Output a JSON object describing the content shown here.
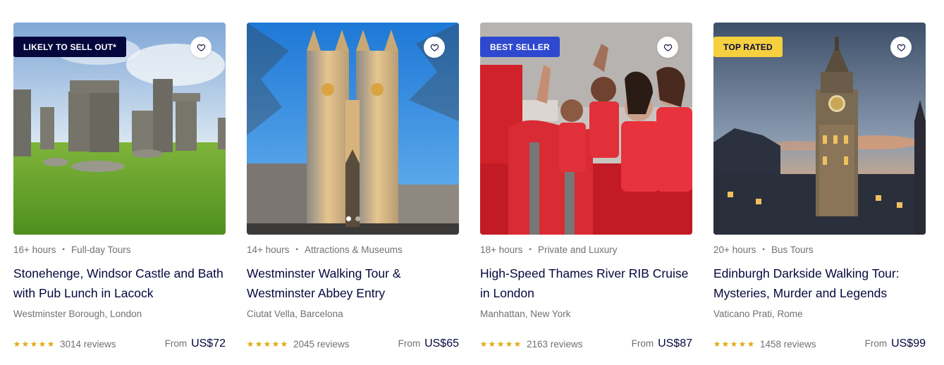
{
  "colors": {
    "heading": "#05073c",
    "muted": "#717171",
    "star": "#e2b123",
    "badge_dark": "#05073c",
    "badge_blue": "#2e48cf",
    "badge_yellow": "#f6d03f"
  },
  "cards": [
    {
      "badge": "LIKELY TO SELL OUT*",
      "badge_style": "dark",
      "image_icon": "stonehenge-photo",
      "duration": "16+ hours",
      "category": "Full-day Tours",
      "title": "Stonehenge, Windsor Castle and Bath with Pub Lunch in Lacock",
      "location": "Westminster Borough, London",
      "rating": 5,
      "reviews": "3014 reviews",
      "price_prefix": "From",
      "price": "US$72"
    },
    {
      "badge": "",
      "badge_style": "",
      "image_icon": "westminster-abbey-photo",
      "carousel_dots": 2,
      "carousel_active": 1,
      "duration": "14+ hours",
      "category": "Attractions & Museums",
      "title": "Westminster Walking Tour & Westminster Abbey Entry",
      "location": "Ciutat Vella, Barcelona",
      "rating": 5,
      "reviews": "2045 reviews",
      "price_prefix": "From",
      "price": "US$65"
    },
    {
      "badge": "BEST SELLER",
      "badge_style": "blue",
      "image_icon": "thames-rib-boat-photo",
      "duration": "18+ hours",
      "category": "Private and Luxury",
      "title": "High-Speed Thames River RIB Cruise in London",
      "location": "Manhattan, New York",
      "rating": 5,
      "reviews": "2163 reviews",
      "price_prefix": "From",
      "price": "US$87"
    },
    {
      "badge": "TOP RATED",
      "badge_style": "yellow",
      "image_icon": "edinburgh-skyline-photo",
      "duration": "20+ hours",
      "category": "Bus Tours",
      "title": "Edinburgh Darkside Walking Tour: Mysteries, Murder and Legends",
      "location": "Vaticano Prati, Rome",
      "rating": 5,
      "reviews": "1458 reviews",
      "price_prefix": "From",
      "price": "US$99"
    }
  ]
}
